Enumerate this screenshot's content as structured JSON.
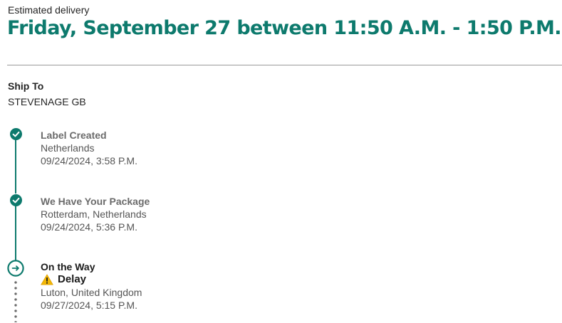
{
  "delivery": {
    "label": "Estimated delivery",
    "date_window": "Friday, September 27 between 11:50 A.M. - 1:50 P.M.",
    "help_icon": "question-circle-icon"
  },
  "ship_to": {
    "title": "Ship To",
    "value": "STEVENAGE GB"
  },
  "events": [
    {
      "title": "Label Created",
      "location": "Netherlands",
      "datetime": "09/24/2024, 3:58 P.M.",
      "status": "completed",
      "icon": "check-circle-icon"
    },
    {
      "title": "We Have Your Package",
      "location": "Rotterdam, Netherlands",
      "datetime": "09/24/2024, 5:36 P.M.",
      "status": "completed",
      "icon": "check-circle-icon"
    },
    {
      "title": "On the Way",
      "alert": "Delay",
      "alert_icon": "warning-icon",
      "location": "Luton, United Kingdom",
      "datetime": "09/27/2024, 5:15 P.M.",
      "status": "current",
      "icon": "arrow-right-circle-icon"
    }
  ],
  "colors": {
    "accent": "#0d7a6d",
    "text": "#242424",
    "muted": "#6b6b6b",
    "warning": "#f2b705"
  }
}
